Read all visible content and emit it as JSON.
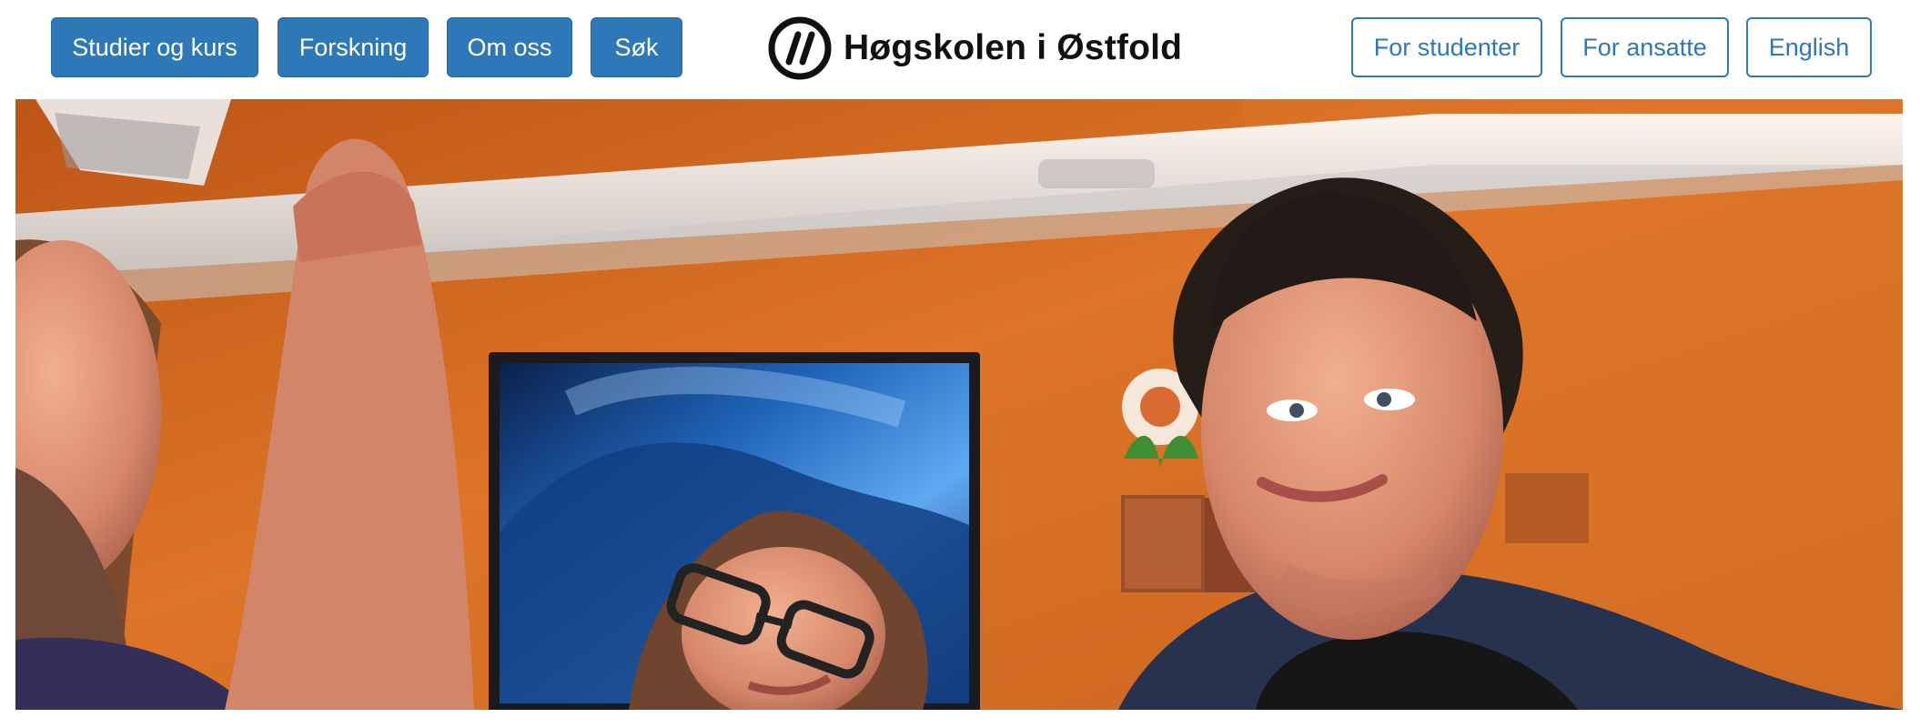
{
  "nav": {
    "studier_label": "Studier og kurs",
    "forskning_label": "Forskning",
    "omoss_label": "Om oss",
    "sok_label": "Søk"
  },
  "logo": {
    "name": "Høgskolen i Østfold",
    "icon": "hiof-logo-mark"
  },
  "audience": {
    "studenter_label": "For studenter",
    "ansatte_label": "For ansatte",
    "english_label": "English"
  },
  "colors": {
    "primary": "#2f78b7",
    "hero_wall": "#d66f22"
  }
}
